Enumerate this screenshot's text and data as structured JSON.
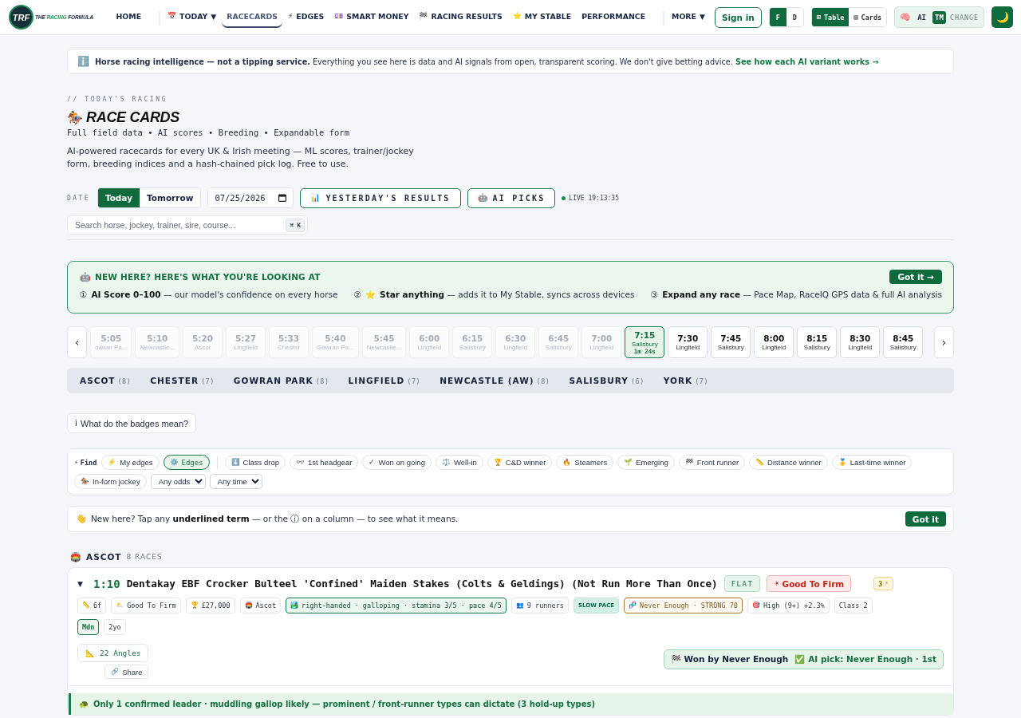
{
  "header": {
    "brand": {
      "badge": "TRF",
      "name_start": "THE",
      "accent": "RACING",
      "name_end": "FORMULA"
    },
    "nav": [
      {
        "items": [
          {
            "label": "HOME",
            "selected": false
          }
        ]
      },
      {
        "items": [
          {
            "icon": "📅",
            "label": "TODAY",
            "caret": "▼",
            "selected": false
          },
          {
            "label": "RACECARDS",
            "selected": true
          },
          {
            "icon": "⚡",
            "label": "EDGES",
            "selected": false
          },
          {
            "icon": "💷",
            "label": "SMART MONEY",
            "selected": false
          },
          {
            "icon": "🏁",
            "label": "RACING RESULTS",
            "selected": false
          },
          {
            "icon": "⭐",
            "label": "MY STABLE",
            "selected": false
          },
          {
            "label": "PERFORMANCE",
            "selected": false
          }
        ]
      },
      {
        "items": [
          {
            "label": "MORE",
            "caret": "▼",
            "selected": false
          }
        ]
      }
    ],
    "sign_in": "Sign in",
    "font_toggle": [
      {
        "label": "F",
        "selected": true
      },
      {
        "label": "D",
        "selected": false
      }
    ],
    "view_toggle": [
      {
        "icon": "⊞",
        "label": "Table",
        "selected": true
      },
      {
        "icon": "▤",
        "label": "Cards",
        "selected": false
      }
    ],
    "model_switch": {
      "icon": "🧠",
      "options": [
        {
          "label": "AI",
          "selected": false
        },
        {
          "label": "TM",
          "selected": true
        }
      ],
      "action": "CHANGE"
    },
    "theme_button": {
      "icon": "🌙"
    }
  },
  "notice": {
    "icon": "ℹ️",
    "text": "**Horse racing intelligence — not a tipping service.** Everything you see here is data and AI signals from open, transparent scoring. We don't give betting advice.",
    "link": "See how each AI variant works →"
  },
  "hero": {
    "eyebrow": "// TODAY'S RACING",
    "icon": "🏇",
    "title": "RACE CARDS",
    "subtitle": "Full field data • AI scores • Breeding • Expandable form",
    "description": "AI-powered racecards for every UK & Irish meeting — ML scores, trainer/jockey form, breeding indices and a hash-chained pick log. Free to use."
  },
  "controls": {
    "date_label": "DATE",
    "day_toggle": [
      {
        "label": "Today",
        "selected": true
      },
      {
        "label": "Tomorrow",
        "selected": false
      }
    ],
    "date_value": "07/25/2026",
    "buttons": [
      {
        "icon": "📊",
        "label": "YESTERDAY'S RESULTS"
      },
      {
        "icon": "🤖",
        "label": "AI PICKS"
      }
    ],
    "live": "LIVE 19:13:35"
  },
  "search": {
    "placeholder": "Search horse, jockey, trainer, sire, course...",
    "shortcut": "⌘ K"
  },
  "onboarding": {
    "icon": "🤖",
    "title": "NEW HERE? HERE'S WHAT YOU'RE LOOKING AT",
    "button": "Got it →",
    "points": [
      {
        "marker": "①",
        "text": "**AI Score 0–100** — our model's confidence on every horse"
      },
      {
        "marker": "②",
        "icon": "⭐",
        "text": "**Star anything** — adds it to My Stable, syncs across devices"
      },
      {
        "marker": "③",
        "text": "**Expand any race** — Pace Map, RaceIQ GPS data & full AI analysis"
      }
    ]
  },
  "race_strip": {
    "prev": "‹",
    "next": "›",
    "races": [
      {
        "time": "5:05",
        "course": "owran Pa...",
        "past": true,
        "selected": false
      },
      {
        "time": "5:10",
        "course": "Newcastle...",
        "past": true,
        "selected": false
      },
      {
        "time": "5:20",
        "course": "Ascot",
        "past": true,
        "selected": false
      },
      {
        "time": "5:27",
        "course": "Lingfield",
        "past": true,
        "selected": false
      },
      {
        "time": "5:33",
        "course": "Chester",
        "past": true,
        "selected": false
      },
      {
        "time": "5:40",
        "course": "Gowran Pa...",
        "past": true,
        "selected": false
      },
      {
        "time": "5:45",
        "course": "Newcastle...",
        "past": true,
        "selected": false
      },
      {
        "time": "6:00",
        "course": "Lingfield",
        "past": true,
        "selected": false
      },
      {
        "time": "6:15",
        "course": "Salisbury",
        "past": true,
        "selected": false
      },
      {
        "time": "6:30",
        "course": "Lingfield",
        "past": true,
        "selected": false
      },
      {
        "time": "6:45",
        "course": "Salisbury",
        "past": true,
        "selected": false
      },
      {
        "time": "7:00",
        "course": "Lingfield",
        "past": true,
        "selected": false
      },
      {
        "time": "7:15",
        "course": "Salisbury",
        "countdown": "1m 24s",
        "past": false,
        "selected": true
      },
      {
        "time": "7:30",
        "course": "Lingfield",
        "past": false,
        "selected": false
      },
      {
        "time": "7:45",
        "course": "Salisbury",
        "past": false,
        "selected": false
      },
      {
        "time": "8:00",
        "course": "Lingfield",
        "past": false,
        "selected": false
      },
      {
        "time": "8:15",
        "course": "Salisbury",
        "past": false,
        "selected": false
      },
      {
        "time": "8:30",
        "course": "Lingfield",
        "past": false,
        "selected": false
      },
      {
        "time": "8:45",
        "course": "Salisbury",
        "past": false,
        "selected": false
      }
    ]
  },
  "meetings": [
    {
      "name": "ASCOT",
      "count": "(8)"
    },
    {
      "name": "CHESTER",
      "count": "(7)"
    },
    {
      "name": "GOWRAN PARK",
      "count": "(8)"
    },
    {
      "name": "LINGFIELD",
      "count": "(7)"
    },
    {
      "name": "NEWCASTLE (AW)",
      "count": "(8)"
    },
    {
      "name": "SALISBURY",
      "count": "(6)"
    },
    {
      "name": "YORK",
      "count": "(7)"
    }
  ],
  "badges_help": {
    "icon": "ℹ",
    "label": "What do the badges mean?"
  },
  "filters": {
    "icon": "⚡",
    "label": "Find",
    "personal": [
      {
        "icon": "⚡",
        "label": "My edges",
        "selected": false
      },
      {
        "icon": "⚙️",
        "label": "Edges",
        "selected": true
      }
    ],
    "signals": [
      {
        "icon": "⬇️",
        "label": "Class drop",
        "selected": false
      },
      {
        "icon": "👓",
        "label": "1st headgear",
        "selected": false
      },
      {
        "icon": "✓",
        "label": "Won on going",
        "selected": false
      },
      {
        "icon": "⚖️",
        "label": "Well-in",
        "selected": false
      },
      {
        "icon": "🏆",
        "label": "C&D winner",
        "selected": false
      },
      {
        "icon": "🔥",
        "label": "Steamers",
        "selected": false
      },
      {
        "icon": "🌱",
        "label": "Emerging",
        "selected": false
      },
      {
        "icon": "🏁",
        "label": "Front runner",
        "selected": false
      },
      {
        "icon": "📏",
        "label": "Distance winner",
        "selected": false
      },
      {
        "icon": "🥇",
        "label": "Last-time winner",
        "selected": false
      },
      {
        "icon": "🏇",
        "label": "In-form jockey",
        "selected": false
      }
    ],
    "selects": [
      {
        "value": "Any odds"
      },
      {
        "value": "Any time"
      }
    ]
  },
  "tip": {
    "icon": "👋",
    "text": "New here? Tap any **underlined term** — or the ⓘ on a column — to see what it means.",
    "button": "Got it"
  },
  "meeting": {
    "icon": "🏟️",
    "name": "ASCOT",
    "count": "8 RACES",
    "race": {
      "caret": "▼",
      "expanded": true,
      "time": "1:10",
      "title": "Dentakay EBF Crocker Bulteel 'Confined' Maiden Stakes (Colts & Geldings) (Not Run More Than Once)",
      "badges": [
        {
          "kind": "type",
          "label": "FLAT"
        },
        {
          "kind": "going",
          "icon": "☀",
          "label": "Good To Firm"
        },
        {
          "kind": "signal",
          "label": "3",
          "icon": "⚡"
        }
      ],
      "facts": [
        {
          "kind": "plain",
          "icon": "📏",
          "label": "6f"
        },
        {
          "kind": "plain",
          "icon": "⛅",
          "label": "Good To Firm"
        },
        {
          "kind": "plain",
          "icon": "🏆",
          "label": "£27,000"
        },
        {
          "kind": "plain",
          "icon": "🏟️",
          "label": "Ascot"
        },
        {
          "kind": "course",
          "icon": "🏞️",
          "label": "right-handed · galloping · stamina 3/5 · pace 4/5"
        },
        {
          "kind": "plain",
          "icon": "👥",
          "label": "9 runners"
        },
        {
          "kind": "pace",
          "label": "SLOW PACE"
        },
        {
          "kind": "breeding",
          "icon": "🧬",
          "label": "Never Enough · STRONG 70"
        },
        {
          "kind": "plain",
          "icon": "🎯",
          "label": "High (9+) +2.3%"
        },
        {
          "kind": "plain",
          "label": "Class 2"
        }
      ],
      "tags": [
        {
          "kind": "type",
          "label": "Mdn"
        },
        {
          "kind": "plain",
          "label": "2yo"
        }
      ],
      "angles": {
        "icon": "📐",
        "label": "22 Angles"
      },
      "share": {
        "icon": "🔗",
        "label": "Share"
      },
      "result": {
        "winner_icon": "🏁",
        "winner": "Won by Never Enough",
        "pick_icon": "✅",
        "pick": "AI pick: Never Enough · 1st"
      },
      "pace_note": {
        "icon": "🐢",
        "text": "Only 1 confirmed leader · muddling gallop likely — prominent / front-runner types can dictate (3 hold-up types)"
      }
    }
  }
}
